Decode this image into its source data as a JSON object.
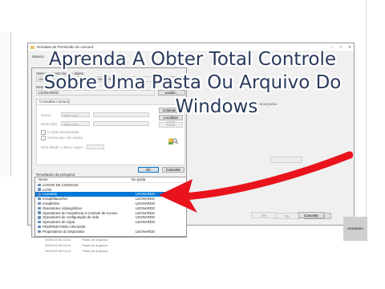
{
  "headline": {
    "line1": "Aprenda A Obter Total Controle",
    "line2": "Sobre Uma Pasta Ou Arquivo Do",
    "line3": "Windows"
  },
  "permissions_window": {
    "title": "Entradas de Permissão de concurd",
    "principal_label": "Selecio",
    "advanced_label": "Mostrar permissões avançadas",
    "ok_label": "OK",
    "cancel_label": "Cancelar"
  },
  "select_dialog": {
    "object_type_label": "Selecionar este tipo de objeto:",
    "object_type_value": "Usuário, Grupo ou Entidade de segurança interna",
    "object_types_button": "Tipos de Objeto...",
    "location_label": "Deste local:",
    "location_value": "LEONARDO",
    "locations_button": "Locais...",
    "tab_common_queries": "Consultas comuns",
    "name_label": "Nome:",
    "name_mode": "Inicia com",
    "description_label": "Descrição:",
    "description_mode": "Inicia com",
    "columns_button": "Colunas...",
    "find_now_button": "Localizar agora",
    "stop_button": "Parar",
    "disabled_accounts_label": "Contas desativadas",
    "non_expiring_label": "Senha que não expira",
    "days_label": "Dias desde o último logon:",
    "ok_label": "OK",
    "cancel_label": "Cancelar",
    "results_label": "Resultados da pesquisa:",
    "col_name": "Nome",
    "col_folder": "No pasta",
    "results": [
      {
        "name": "LOGON DE CONSOLE",
        "folder": "",
        "selected": false
      },
      {
        "name": "LOTE",
        "folder": "",
        "selected": false
      },
      {
        "name": "Leonardo",
        "folder": "LEONARDO",
        "selected": true
      },
      {
        "name": "mssqlfdlauncher",
        "folder": "LEONARDO",
        "selected": false
      },
      {
        "name": "mssqlfxlien",
        "folder": "LEONARDO",
        "selected": false
      },
      {
        "name": "Operadores criptográficos",
        "folder": "LEONARDO",
        "selected": false
      },
      {
        "name": "Operadores de Assistência a Controle de Acesso",
        "folder": "LEONARDO",
        "selected": false
      },
      {
        "name": "Operadores de configuração de rede",
        "folder": "LEONARDO",
        "selected": false
      },
      {
        "name": "Operadores de cópia",
        "folder": "LEONARDO",
        "selected": false
      },
      {
        "name": "PROPRIETÁRIO CRIADOR",
        "folder": "",
        "selected": false
      },
      {
        "name": "Proprietários do Dispositivo",
        "folder": "LEONARDO",
        "selected": false
      }
    ]
  },
  "background_files": [
    {
      "date": "09/02/19 09:13:13",
      "type": "Pasta de arquivos"
    },
    {
      "date": "09/02/19 08:16:13",
      "type": "Pasta de arquivos"
    },
    {
      "date": "09/02/19 08:14:13",
      "type": "Pasta de arquivos"
    }
  ],
  "bottom_buttons": {
    "ok": "OK",
    "cancel": "Cancelar"
  },
  "logo_text": "LEONARDO",
  "colors": {
    "arrow": "#e8131c",
    "selection": "#0078d7",
    "headline": "#2a3a5c"
  }
}
